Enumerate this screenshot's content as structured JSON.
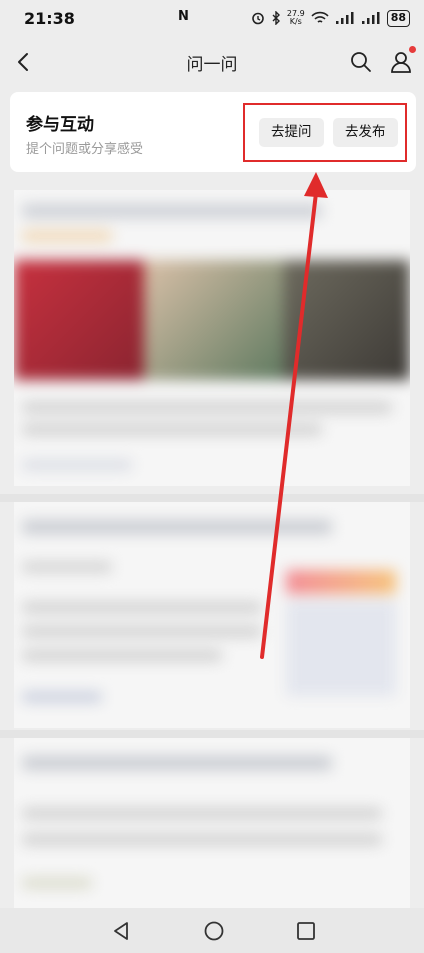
{
  "status_bar": {
    "time": "21:38",
    "nfc": "N",
    "net_speed_value": "27.9",
    "net_speed_unit": "K/s",
    "battery": "88",
    "icons": [
      "alarm-icon",
      "bluetooth-icon",
      "wifi-icon",
      "signal-icon",
      "signal-icon",
      "battery-icon"
    ]
  },
  "header": {
    "title": "问一问",
    "icons": [
      "back-icon",
      "search-icon",
      "user-icon"
    ]
  },
  "interact": {
    "title": "参与互动",
    "subtitle": "提个问题或分享感受",
    "ask_button": "去提问",
    "post_button": "去发布"
  },
  "colors": {
    "annotation_red": "#e02b2b",
    "notification_dot": "#e63b3b",
    "background": "#ededed"
  },
  "nav_bar": {
    "icons": [
      "back-triangle-icon",
      "home-circle-icon",
      "recent-square-icon"
    ]
  }
}
